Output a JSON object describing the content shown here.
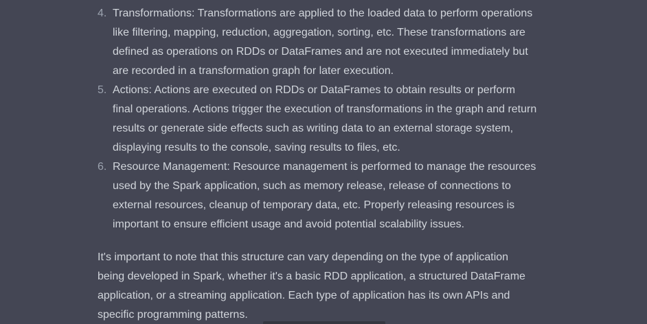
{
  "list": {
    "items": [
      {
        "number": "4.",
        "text": "Transformations: Transformations are applied to the loaded data to perform operations like filtering, mapping, reduction, aggregation, sorting, etc. These transformations are defined as operations on RDDs or DataFrames and are not executed immediately but are recorded in a transformation graph for later execution."
      },
      {
        "number": "5.",
        "text": "Actions: Actions are executed on RDDs or DataFrames to obtain results or perform final operations. Actions trigger the execution of transformations in the graph and return results or generate side effects such as writing data to an external storage system, displaying results to the console, saving results to files, etc."
      },
      {
        "number": "6.",
        "text": "Resource Management: Resource management is performed to manage the resources used by the Spark application, such as memory release, release of connections to external resources, cleanup of temporary data, etc. Properly releasing resources is important to ensure efficient usage and avoid potential scalability issues."
      }
    ]
  },
  "paragraph": {
    "text": "It's important to note that this structure can vary depending on the type of application being developed in Spark, whether it's a basic RDD application, a structured DataFrame application, or a streaming application. Each type of application has its own APIs and specific programming patterns."
  },
  "colors": {
    "background": "#444654",
    "text": "#d1d5db",
    "list_number": "#9ca3af"
  }
}
